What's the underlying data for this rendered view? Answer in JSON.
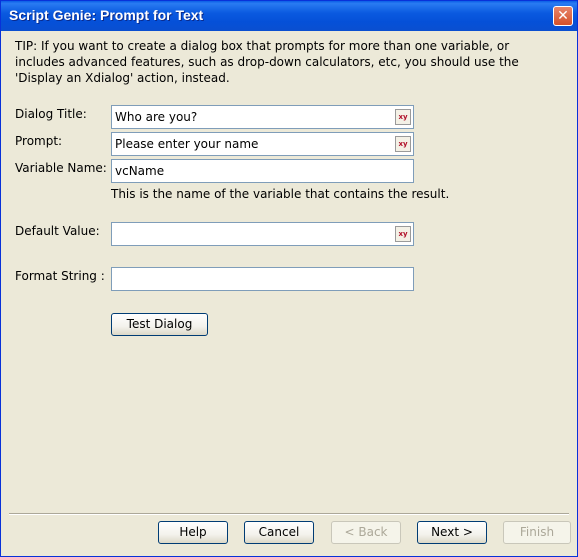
{
  "window": {
    "title": "Script Genie:  Prompt for Text",
    "close_glyph": "✕"
  },
  "tip": "TIP: If you want to create a dialog box that prompts for more than one variable, or includes advanced features, such as drop-down calculators, etc, you should use the 'Display an Xdialog' action, instead.",
  "fields": {
    "dialog_title": {
      "label": "Dialog Title:",
      "value": "Who are you?",
      "expr_icon": "expression-builder-icon"
    },
    "prompt": {
      "label": "Prompt:",
      "value": "Please enter your name",
      "expr_icon": "expression-builder-icon"
    },
    "variable_name": {
      "label": "Variable Name:",
      "value": "vcName",
      "hint": "This is the name of the variable that contains the result."
    },
    "default_value": {
      "label": "Default Value:",
      "value": "",
      "expr_icon": "expression-builder-icon"
    },
    "format_string": {
      "label": "Format String :",
      "value": ""
    }
  },
  "expr_icon_text": "xy",
  "test_button": "Test Dialog",
  "footer": {
    "help": {
      "label": "Help",
      "enabled": true
    },
    "cancel": {
      "label": "Cancel",
      "enabled": true
    },
    "back": {
      "label": "< Back",
      "enabled": false
    },
    "next": {
      "label": "Next >",
      "enabled": true
    },
    "finish": {
      "label": "Finish",
      "enabled": false
    }
  }
}
